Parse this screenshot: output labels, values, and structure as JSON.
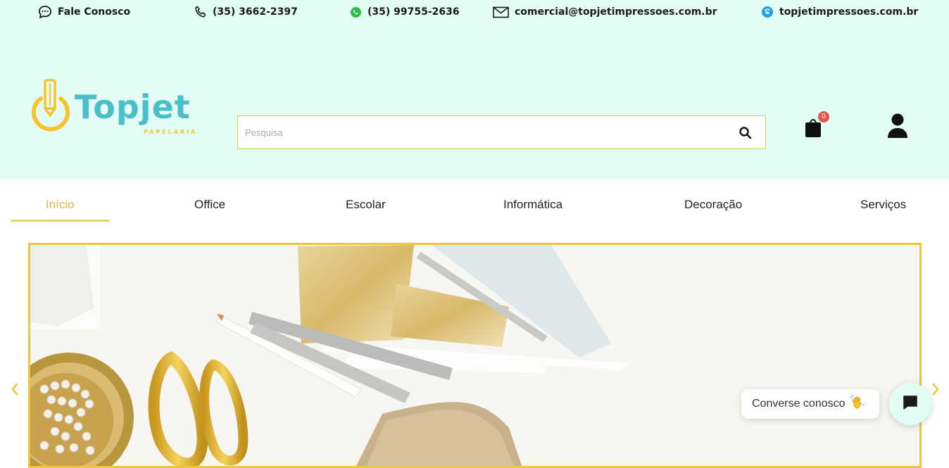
{
  "topbar": {
    "contact_label": "Fale Conosco",
    "phone": "(35) 3662-2397",
    "whatsapp": "(35) 99755-2636",
    "email": "comercial@topjetimpressoes.com.br",
    "skype": "topjetimpressoes.com.br"
  },
  "logo": {
    "name": "Topjet",
    "tagline": "PAPELARIA"
  },
  "search": {
    "placeholder": "Pesquisa"
  },
  "cart": {
    "count": "0"
  },
  "nav": {
    "items": [
      "Início",
      "Office",
      "Escolar",
      "Informática",
      "Decoração",
      "Serviços"
    ],
    "active": "Início"
  },
  "chat": {
    "bubble_text": "Converse conosco"
  },
  "colors": {
    "header_bg": "#e3fdf6",
    "accent_yellow": "#f2c53d",
    "logo_teal": "#4bbfc9",
    "active_nav": "#d9b93a",
    "badge_red": "#e2574c"
  }
}
